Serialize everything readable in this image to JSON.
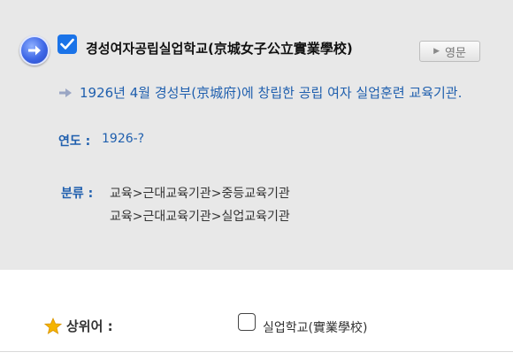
{
  "entry": {
    "title": "경성여자공립실업학교(京城女子公立實業學校)",
    "lang_button": "영문",
    "description": "1926년 4월 경성부(京城府)에 창립한 공립 여자 실업훈련 교육기관.",
    "year_label": "연도 :",
    "year_value": "1926-?",
    "category_label": "분류 :",
    "categories": [
      "교육>근대교육기관>중등교육기관",
      "교육>근대교육기관>실업교육기관"
    ]
  },
  "related": {
    "parent_label": "상위어 :",
    "parent_value": "실업학교(實業學校)"
  },
  "colors": {
    "accent_blue": "#1f5fae",
    "check_blue": "#1a73e8",
    "card_bg": "#e8e8e8",
    "star": "#f5b400"
  },
  "icons": [
    "arrow-circle-icon",
    "checkbox-checked-icon",
    "play-icon",
    "arrow-right-icon",
    "star-icon",
    "checkbox-empty-icon"
  ]
}
